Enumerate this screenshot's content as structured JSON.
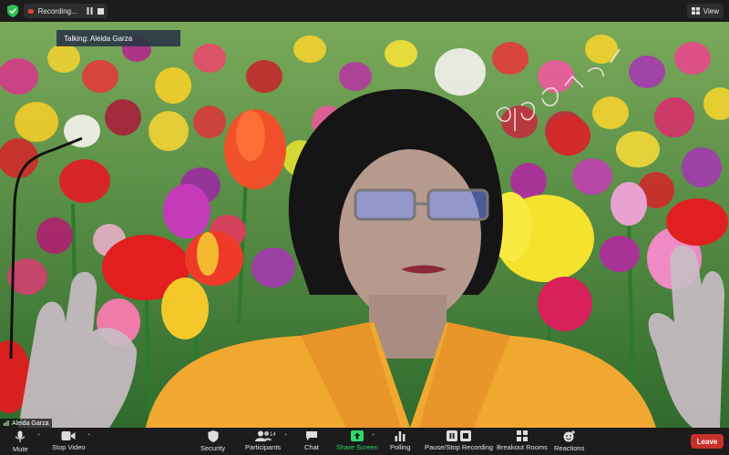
{
  "top_bar": {
    "recording_label": "Recording...",
    "view_label": "View"
  },
  "video": {
    "talking_indicator": "Talking: Aleida Garza",
    "participant_name": "Aleida Garza"
  },
  "toolbar": {
    "mute_label": "Mute",
    "stop_video_label": "Stop Video",
    "security_label": "Security",
    "participants_label": "Participants",
    "participants_count": "14",
    "chat_label": "Chat",
    "share_screen_label": "Share Screen",
    "polling_label": "Polling",
    "recording_label": "Pause/Stop Recording",
    "breakout_label": "Breakout Rooms",
    "reactions_label": "Reactions",
    "leave_label": "Leave"
  },
  "colors": {
    "share_green": "#2fd96a",
    "leave_red": "#c8312a",
    "recording_red": "#e2453c"
  }
}
